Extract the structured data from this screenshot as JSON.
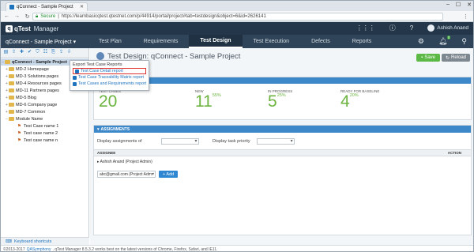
{
  "browser": {
    "tab_title": "qConnect - Sample Project",
    "secure_label": "Secure",
    "url": "https://learnbasicqtest.qtestnet.com/p/44914/portal/project#tab=testdesign&object=6&id=2626141"
  },
  "app": {
    "logo_letter": "q",
    "name": "qTest",
    "product": "Manager",
    "user_name": "Ashish Anand",
    "notification_count": "0"
  },
  "nav": {
    "project": "qConnect - Sample Project ▾",
    "tabs": [
      {
        "label": "Test Plan"
      },
      {
        "label": "Requirements"
      },
      {
        "label": "Test Design"
      },
      {
        "label": "Test Execution"
      },
      {
        "label": "Defects"
      },
      {
        "label": "Reports"
      }
    ],
    "active_tab": "Test Design"
  },
  "tree": {
    "nodes": [
      {
        "label": "qConnect - Sample Project",
        "type": "root"
      },
      {
        "label": "MD-2 Homepage",
        "type": "folder"
      },
      {
        "label": "MD-3 Solutions pages",
        "type": "folder"
      },
      {
        "label": "MD-4 Resources pages",
        "type": "folder"
      },
      {
        "label": "MD-11 Partners pages",
        "type": "folder"
      },
      {
        "label": "MD-5 Blog",
        "type": "folder"
      },
      {
        "label": "MD-6 Company page",
        "type": "folder"
      },
      {
        "label": "MD-7 Common",
        "type": "folder"
      },
      {
        "label": "Module Name",
        "type": "folder"
      },
      {
        "label": "Test Case name 1",
        "type": "testcase"
      },
      {
        "label": "Test case name 2",
        "type": "testcase"
      },
      {
        "label": "Test case name n",
        "type": "testcase"
      }
    ],
    "keyboard_shortcuts": "Keyboard shortcuts"
  },
  "main": {
    "title": "Test Design: qConnect - Sample Project",
    "save_label": "Save",
    "reload_label": "Reload",
    "stats": [
      {
        "label": "TEST CASES",
        "value": "20",
        "pct": ""
      },
      {
        "label": "NEW",
        "value": "11",
        "pct": "55%"
      },
      {
        "label": "IN PROGRESS",
        "value": "5",
        "pct": "25%"
      },
      {
        "label": "READY FOR BASELINE",
        "value": "4",
        "pct": "20%"
      }
    ],
    "assignments": {
      "header": "ASSIGNMENTS",
      "display_of_label": "Display assignments of",
      "display_priority_label": "Display task priority",
      "col_assignee": "ASSIGNEE",
      "col_action": "ACTION",
      "row": "Ashish Anand (Project Admin)",
      "select_value": "abc@gmail.com (Project Adm",
      "add_label": "+ Add"
    }
  },
  "popup": {
    "heading": "Export Test Case Reports",
    "items": [
      {
        "label": "Test Case Detail report"
      },
      {
        "label": "Test Case Traceability Matrix report"
      },
      {
        "label": "Test Cases and Requirements report"
      }
    ]
  },
  "footer": {
    "copyright": "©2013-2017",
    "company": "QASymphony",
    "text": ". qTest Manager 8.5.3.2 works best on the latest versions of Chrome, Firefox, Safari, and IE11."
  }
}
